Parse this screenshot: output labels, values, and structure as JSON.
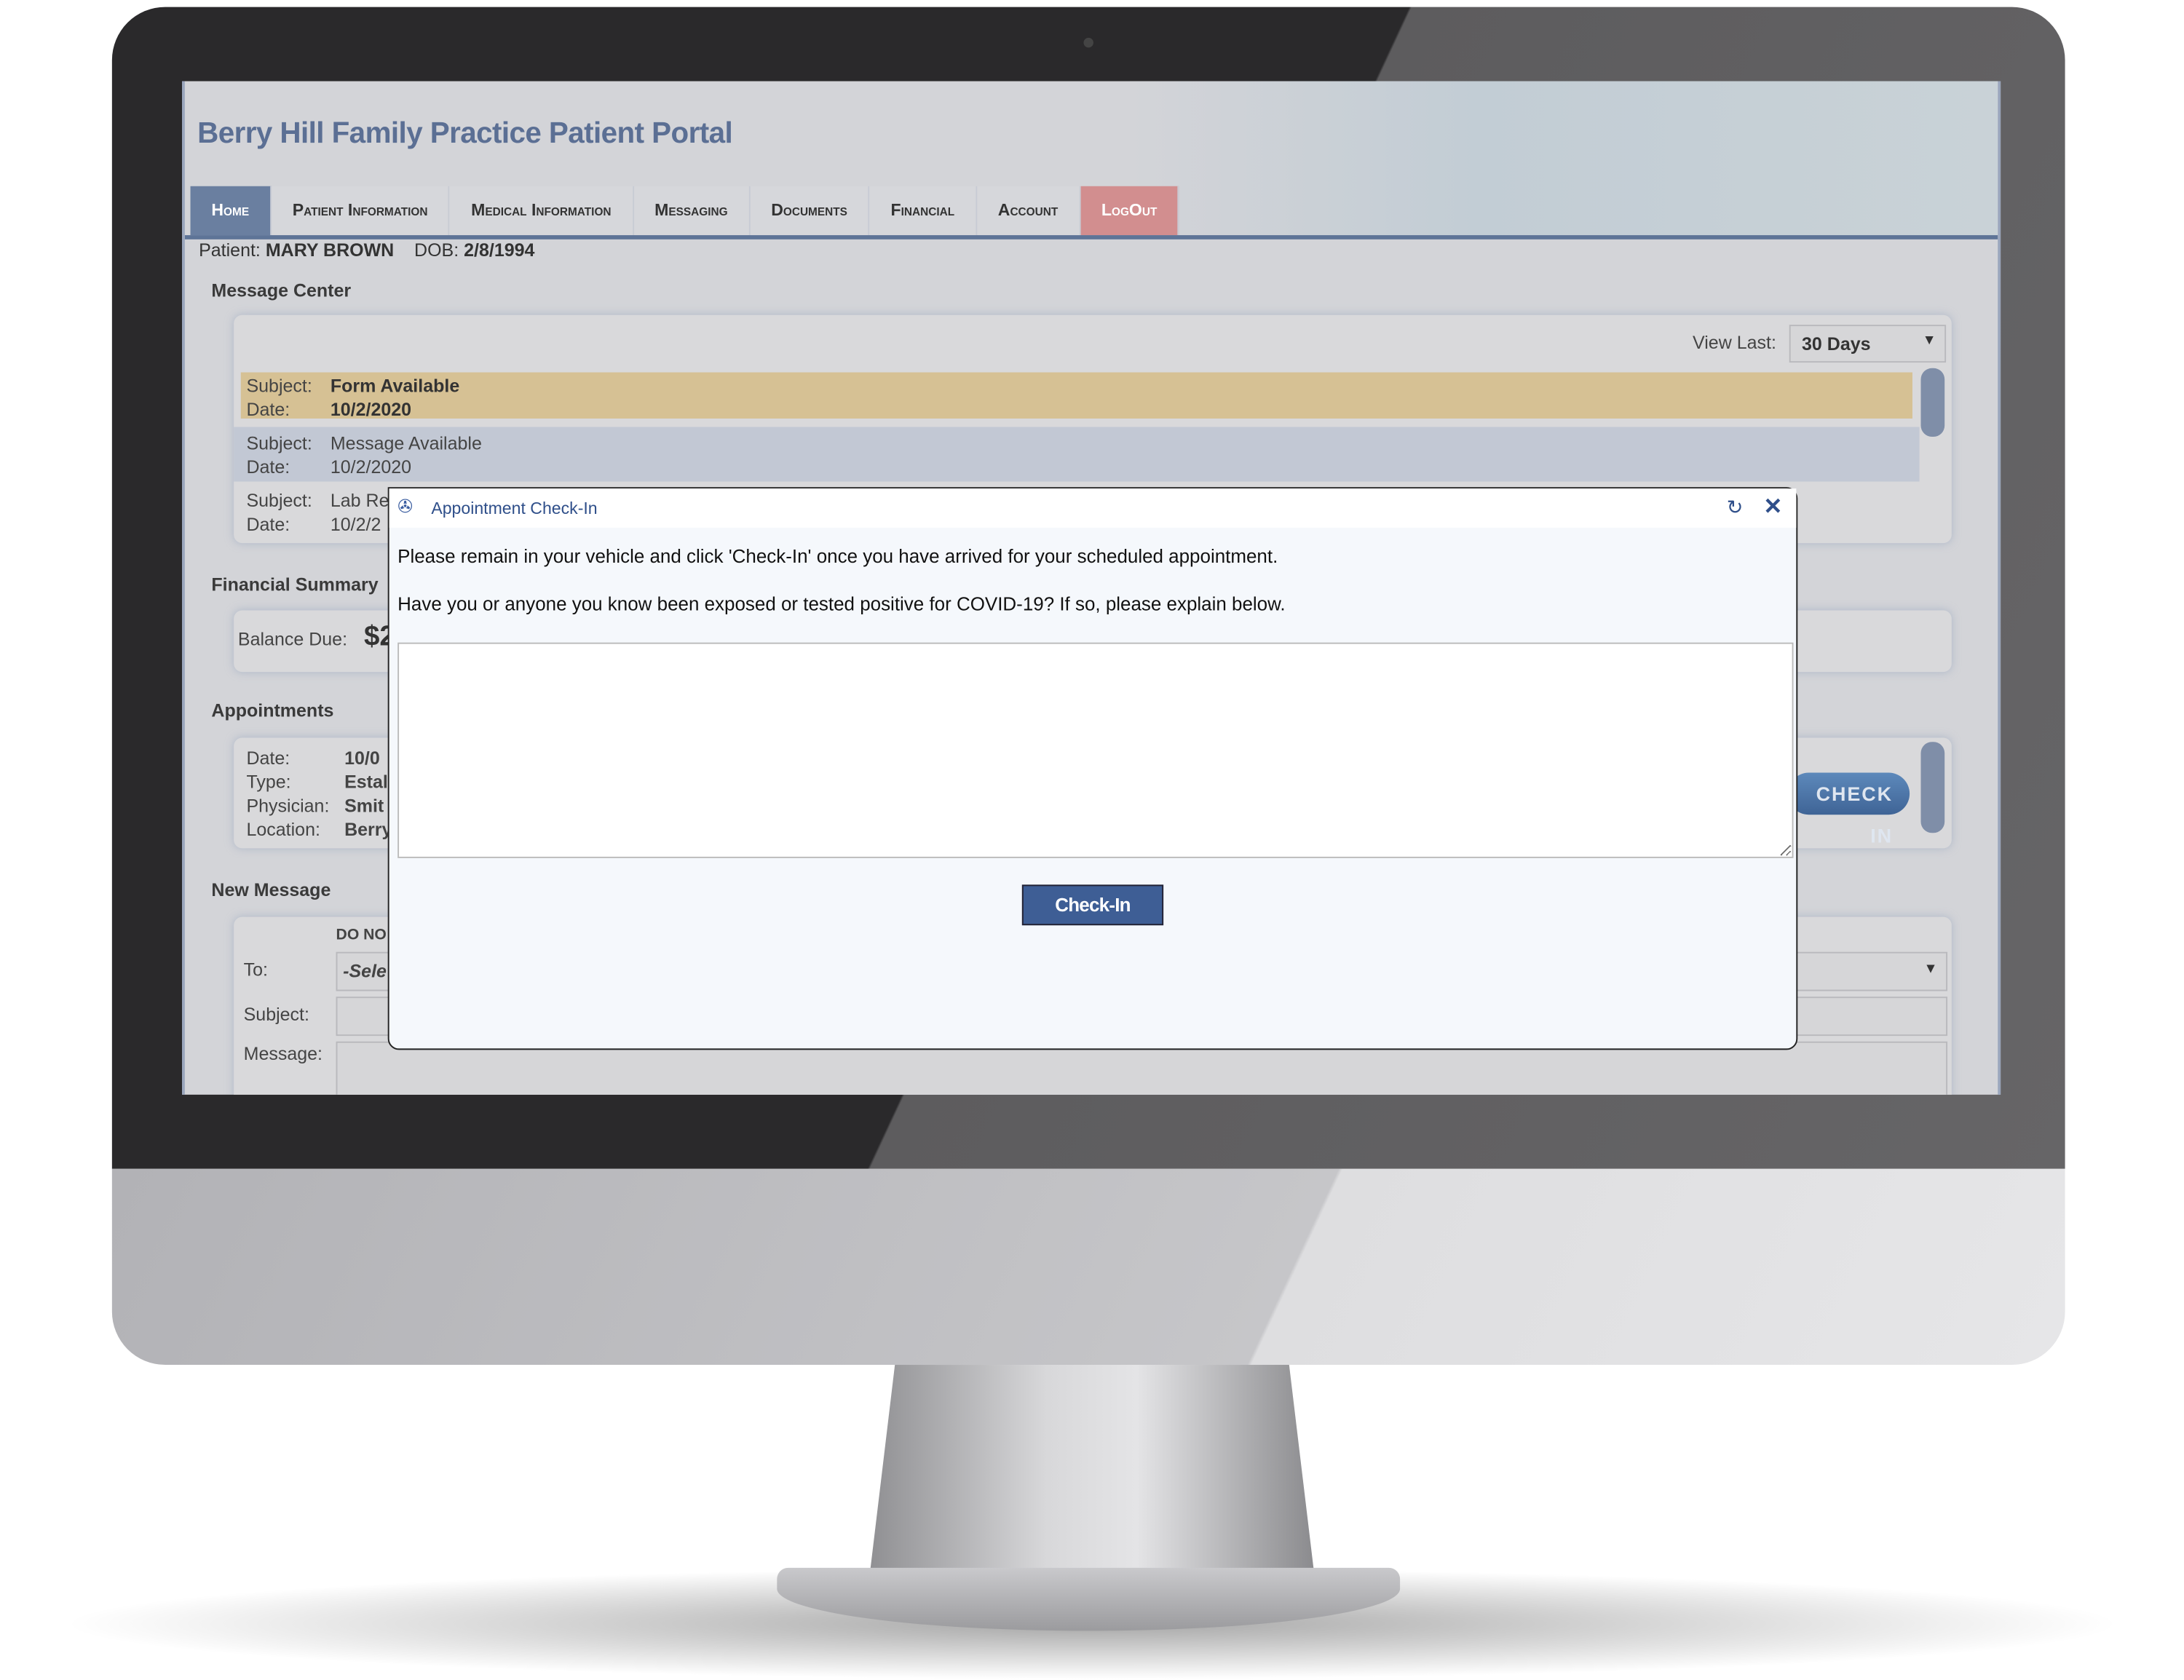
{
  "portal_title": "Berry Hill Family Practice Patient Portal",
  "nav": [
    "Home",
    "Patient Information",
    "Medical Information",
    "Messaging",
    "Documents",
    "Financial",
    "Account",
    "LogOut"
  ],
  "patient": {
    "label": "Patient:",
    "name": "MARY BROWN",
    "dob_label": "DOB:",
    "dob": "2/8/1994"
  },
  "message_center": {
    "title": "Message Center",
    "view_last_label": "View Last:",
    "view_last_value": "30 Days",
    "messages": [
      {
        "subject_label": "Subject:",
        "subject": "Form Available",
        "date_label": "Date:",
        "date": "10/2/2020"
      },
      {
        "subject_label": "Subject:",
        "subject": "Message Available",
        "date_label": "Date:",
        "date": "10/2/2020"
      },
      {
        "subject_label": "Subject:",
        "subject": "Lab Re",
        "date_label": "Date:",
        "date": "10/2/2"
      }
    ]
  },
  "financial": {
    "title": "Financial Summary",
    "balance_label": "Balance Due:",
    "balance": "$2"
  },
  "appointments": {
    "title": "Appointments",
    "date_label": "Date:",
    "date": "10/0",
    "type_label": "Type:",
    "type": "Estal",
    "physician_label": "Physician:",
    "physician": "Smit",
    "location_label": "Location:",
    "location": "Berry",
    "check_in": "CHECK IN"
  },
  "new_message": {
    "title": "New Message",
    "notice": "DO NO",
    "to_label": "To:",
    "to_value": "-Sele",
    "subject_label": "Subject:",
    "message_label": "Message:"
  },
  "modal": {
    "title": "Appointment Check-In",
    "line1": "Please remain in your vehicle and click 'Check-In' once you have arrived for your scheduled appointment.",
    "line2": "Have you or anyone you know been exposed or tested positive for COVID-19? If so, please explain below.",
    "textarea_value": "",
    "button": "Check-In",
    "icons": [
      "refresh-icon",
      "close-icon"
    ]
  },
  "colors": {
    "nav_active": "#6a7fa0",
    "logout": "#d28e8f",
    "unread_row": "#d6c194",
    "read_row": "#c2c8d4",
    "button": "#3e5e95"
  }
}
